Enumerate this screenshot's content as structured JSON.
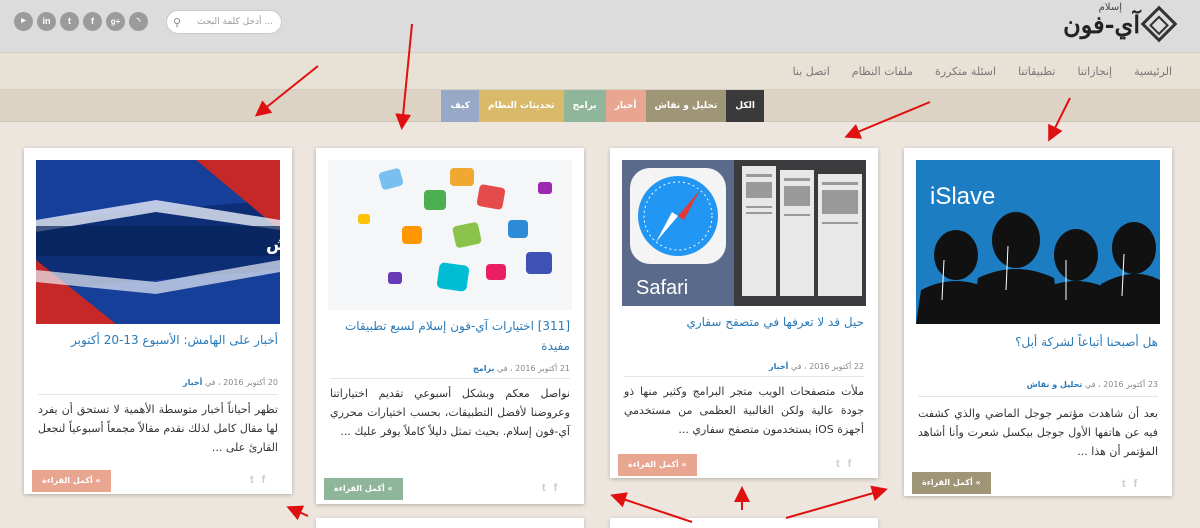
{
  "search": {
    "placeholder": "أدخل كلمة البحث ..."
  },
  "social": [
    "YouTube",
    "in",
    "t",
    "f",
    "g+",
    "rss"
  ],
  "logo": {
    "text": "آي-فون",
    "sub": "إسلام"
  },
  "nav": [
    "الرئيسية",
    "إنجازاتنا",
    "تطبيقاتنا",
    "اسئلة متكررة",
    "ملفات النظام",
    "اتصل بنا"
  ],
  "categories": [
    {
      "label": "الكل",
      "color": "#3a3a3a"
    },
    {
      "label": "تحليل و نقاش",
      "color": "#9f9577"
    },
    {
      "label": "أخبار",
      "color": "#e8a590"
    },
    {
      "label": "برامج",
      "color": "#8fb59a"
    },
    {
      "label": "تحديثات النظام",
      "color": "#d9ba6a"
    },
    {
      "label": "كيف",
      "color": "#98a9c8"
    }
  ],
  "cards": [
    {
      "title": "هل أصبحنا أتباعاً لشركة أبل؟",
      "image_text": "iSlave",
      "date": "23 أكتوبر 2016",
      "in": "، في",
      "category": "تحليل و نقاش",
      "excerpt": "بعد أن شاهدت مؤتمر جوجل الماضي والذي كشفت فيه عن هاتفها الأول جوجل بيكسل شعرت وأنا أشاهد المؤتمر أن هذا ...",
      "more": "أكمل القراءة «",
      "more_color": "#9f9577"
    },
    {
      "title": "حيل قد لا تعرفها في متصفح سفاري",
      "image_text": "Safari",
      "date": "22 أكتوبر 2016",
      "in": "، في",
      "category": "أخبار",
      "excerpt": "ملأت متصفحات الويب متجر البرامج وكثير منها ذو جودة عالية ولكن الغالبية العظمى من مستخدمي أجهزة iOS يستخدمون متصفح سفاري ...",
      "more": "أكمل القراءة «",
      "more_color": "#e8a590"
    },
    {
      "title": "[311] اختيارات آي-فون إسلام لسبع تطبيقات مفيدة",
      "date": "21 أكتوبر 2016",
      "in": "، في",
      "category": "برامج",
      "excerpt": "نواصل معكم وبشكل أسبوعي تقديم اختياراتنا وعروضنا لأفضل التطبيقات، بحسب اختيارات محرري آي-فون إسلام. بحيث تمثل دليلاً كاملاً يوفر عليك ...",
      "more": "أكمل القراءة «",
      "more_color": "#8fb59a"
    },
    {
      "title": "أخبار على الهامش: الأسبوع 13-20 أكتوبر",
      "image_text": "أخبار على الهامش",
      "date": "20 أكتوبر 2016",
      "in": "، في",
      "category": "أخبار",
      "excerpt": "تظهر أحياناً أخبار متوسطة الأهمية لا تستحق أن يفرد لها مقال كامل لذلك نقدم مقالاً مجمعاً أسبوعياً لنجعل القارئ على ...",
      "more": "أكمل القراءة «",
      "more_color": "#e8a590"
    }
  ]
}
